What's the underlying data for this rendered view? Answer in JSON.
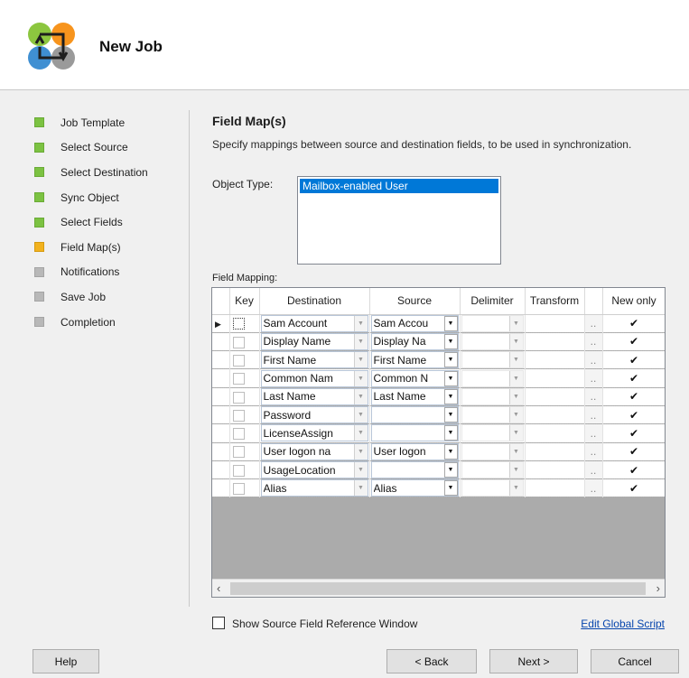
{
  "header": {
    "title": "New Job"
  },
  "steps": [
    {
      "label": "Job Template",
      "state": "done"
    },
    {
      "label": "Select Source",
      "state": "done"
    },
    {
      "label": "Select Destination",
      "state": "done"
    },
    {
      "label": "Sync Object",
      "state": "done"
    },
    {
      "label": "Select Fields",
      "state": "done"
    },
    {
      "label": "Field Map(s)",
      "state": "current"
    },
    {
      "label": "Notifications",
      "state": "todo"
    },
    {
      "label": "Save Job",
      "state": "todo"
    },
    {
      "label": "Completion",
      "state": "todo"
    }
  ],
  "page": {
    "title": "Field Map(s)",
    "description": "Specify mappings between source and destination fields, to be used in synchronization.",
    "object_type_label": "Object Type:",
    "object_types": [
      "Mailbox-enabled User"
    ],
    "field_mapping_label": "Field Mapping:"
  },
  "grid": {
    "columns": [
      "Key",
      "Destination",
      "Source",
      "Delimiter",
      "Transform",
      "New only"
    ],
    "rows": [
      {
        "destination": "Sam Account",
        "source": "Sam Accou",
        "new_only": true
      },
      {
        "destination": "Display Name",
        "source": "Display Na",
        "new_only": true
      },
      {
        "destination": "First Name",
        "source": "First Name",
        "new_only": true
      },
      {
        "destination": "Common Nam",
        "source": "Common N",
        "new_only": true
      },
      {
        "destination": "Last Name",
        "source": "Last Name",
        "new_only": true
      },
      {
        "destination": "Password",
        "source": "",
        "new_only": true
      },
      {
        "destination": "LicenseAssign",
        "source": "",
        "new_only": true
      },
      {
        "destination": "User logon na",
        "source": "User logon",
        "new_only": true
      },
      {
        "destination": "UsageLocation",
        "source": "",
        "new_only": true
      },
      {
        "destination": "Alias",
        "source": "Alias",
        "new_only": true
      }
    ],
    "transform_button": "..",
    "check_glyph": "✔"
  },
  "options": {
    "show_reference_label": "Show Source Field Reference Window",
    "show_reference_checked": false,
    "edit_script_link": "Edit Global Script"
  },
  "buttons": {
    "help": "Help",
    "back": "< Back",
    "next": "Next >",
    "cancel": "Cancel"
  },
  "colors": {
    "done": "#7cc242",
    "current": "#f2b21e",
    "todo": "#b8b8b8",
    "selection": "#0078d7",
    "link": "#0645ad"
  }
}
